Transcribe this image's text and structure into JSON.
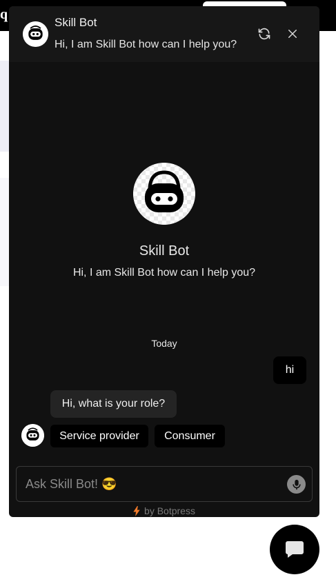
{
  "host": {
    "logo_text": "q"
  },
  "header": {
    "bot_name": "Skill Bot",
    "greeting": "Hi, I am Skill Bot how can I help you?",
    "refresh_icon": "refresh-icon",
    "close_icon": "close-icon"
  },
  "intro": {
    "bot_name": "Skill Bot",
    "description": "Hi, I am Skill Bot how can I help you?"
  },
  "conversation": {
    "date_label": "Today",
    "user_message": "hi",
    "bot_message": "Hi, what is your role?",
    "choices": [
      "Service provider",
      "Consumer"
    ]
  },
  "composer": {
    "placeholder": "Ask Skill Bot! 😎",
    "value": "",
    "mic_icon": "microphone-icon"
  },
  "footer": {
    "prefix_icon": "lightning-icon",
    "label": "by Botpress"
  },
  "launcher": {
    "icon": "chat-bubble-icon"
  },
  "colors": {
    "widget_bg": "#111111",
    "header_bg": "#171717",
    "bot_bubble": "#242424",
    "user_bubble": "#000000",
    "accent_bolt": "#f07a2a"
  }
}
